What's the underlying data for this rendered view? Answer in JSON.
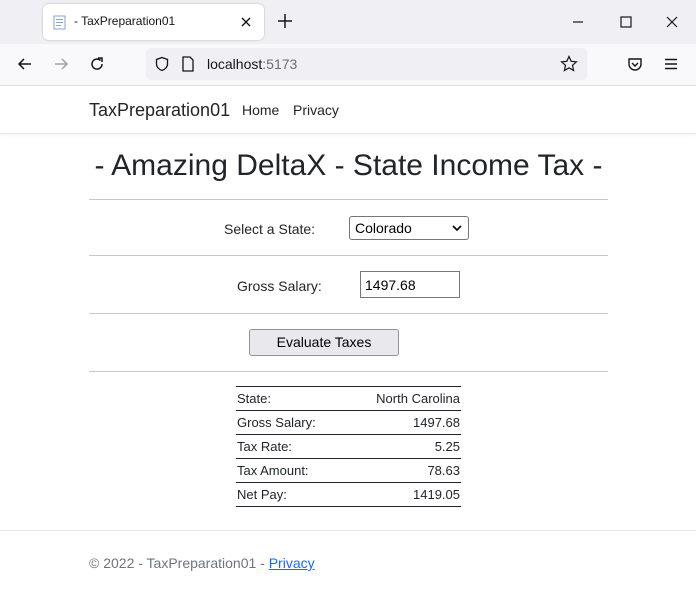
{
  "browser": {
    "tab_title": "- TaxPreparation01",
    "url_host": "localhost",
    "url_port": ":5173"
  },
  "site": {
    "brand": "TaxPreparation01",
    "nav": [
      {
        "label": "Home"
      },
      {
        "label": "Privacy"
      }
    ]
  },
  "main": {
    "title": "- Amazing DeltaX - State Income Tax -",
    "state_label": "Select a State:",
    "state_selected": "Colorado",
    "salary_label": "Gross Salary:",
    "salary_value": "1497.68",
    "evaluate_button": "Evaluate Taxes"
  },
  "results": [
    {
      "label": "State:",
      "value": "North Carolina"
    },
    {
      "label": "Gross Salary:",
      "value": "1497.68"
    },
    {
      "label": "Tax Rate:",
      "value": "5.25"
    },
    {
      "label": "Tax Amount:",
      "value": "78.63"
    },
    {
      "label": "Net Pay:",
      "value": "1419.05"
    }
  ],
  "footer": {
    "copyright": "© 2022 - TaxPreparation01 - ",
    "privacy_link": "Privacy"
  },
  "colors": {
    "link": "#0d6efd",
    "footer_text": "#6c757d"
  }
}
